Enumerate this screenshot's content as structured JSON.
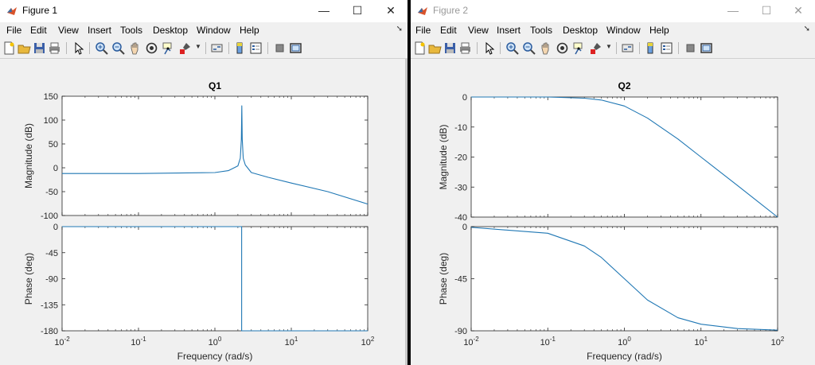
{
  "windows": [
    {
      "title": "Figure 1",
      "controls": {
        "minimize": "—",
        "maximize": "☐",
        "close": "✕"
      },
      "menu": [
        "File",
        "Edit",
        "View",
        "Insert",
        "Tools",
        "Desktop",
        "Window",
        "Help"
      ],
      "toolbar": [
        "new-figure-icon",
        "open-icon",
        "save-icon",
        "print-icon",
        "pointer-icon",
        "zoom-in-icon",
        "zoom-out-icon",
        "pan-icon",
        "rotate-icon",
        "data-cursor-icon",
        "brush-icon",
        "link-icon",
        "colorbar-icon",
        "legend-icon",
        "hide-plot-tools-icon",
        "show-plot-tools-icon"
      ],
      "plot": {
        "title": "Q1",
        "xlabel": "Frequency  (rad/s)",
        "mag_ylabel": "Magnitude (dB)",
        "phase_ylabel": "Phase (deg)",
        "mag_ticks": [
          "150",
          "100",
          "50",
          "0",
          "-50",
          "-100"
        ],
        "phase_ticks": [
          "0",
          "-45",
          "-90",
          "-135",
          "-180"
        ],
        "x_tick_exponents": [
          "-2",
          "-1",
          "0",
          "1",
          "2"
        ]
      }
    },
    {
      "title": "Figure 2",
      "controls": {
        "minimize": "—",
        "maximize": "☐",
        "close": "✕"
      },
      "menu": [
        "File",
        "Edit",
        "View",
        "Insert",
        "Tools",
        "Desktop",
        "Window",
        "Help"
      ],
      "toolbar": [
        "new-figure-icon",
        "open-icon",
        "save-icon",
        "print-icon",
        "pointer-icon",
        "zoom-in-icon",
        "zoom-out-icon",
        "pan-icon",
        "rotate-icon",
        "data-cursor-icon",
        "brush-icon",
        "link-icon",
        "colorbar-icon",
        "legend-icon",
        "hide-plot-tools-icon",
        "show-plot-tools-icon"
      ],
      "plot": {
        "title": "Q2",
        "xlabel": "Frequency  (rad/s)",
        "mag_ylabel": "Magnitude (dB)",
        "phase_ylabel": "Phase (deg)",
        "mag_ticks": [
          "0",
          "-10",
          "-20",
          "-30",
          "-40"
        ],
        "phase_ticks": [
          "0",
          "-45",
          "-90"
        ],
        "x_tick_exponents": [
          "-2",
          "-1",
          "0",
          "1",
          "2"
        ]
      }
    }
  ],
  "chart_data": [
    {
      "type": "line",
      "title": "Q1",
      "xlabel": "Frequency  (rad/s)",
      "xscale": "log",
      "xlim": [
        0.01,
        100
      ],
      "subplots": [
        {
          "ylabel": "Magnitude (dB)",
          "ylim": [
            -100,
            150
          ],
          "x": [
            0.01,
            0.1,
            1,
            1.5,
            2,
            2.15,
            2.22,
            2.25,
            2.28,
            2.35,
            2.5,
            3,
            5,
            10,
            30,
            100
          ],
          "y": [
            -12,
            -12,
            -10,
            -6,
            4,
            20,
            60,
            130,
            60,
            20,
            6,
            -10,
            -20,
            -32,
            -50,
            -76
          ]
        },
        {
          "ylabel": "Phase (deg)",
          "ylim": [
            -180,
            0
          ],
          "x": [
            0.01,
            2.24,
            2.24,
            100
          ],
          "y": [
            0,
            0,
            -180,
            -180
          ]
        }
      ],
      "color": "#1f77b4",
      "grid": false
    },
    {
      "type": "line",
      "title": "Q2",
      "xlabel": "Frequency  (rad/s)",
      "xscale": "log",
      "xlim": [
        0.01,
        100
      ],
      "subplots": [
        {
          "ylabel": "Magnitude (dB)",
          "ylim": [
            -40,
            0
          ],
          "x": [
            0.01,
            0.1,
            0.3,
            0.5,
            1,
            2,
            5,
            10,
            30,
            100
          ],
          "y": [
            0,
            0,
            -0.4,
            -1,
            -3,
            -7,
            -14,
            -20,
            -29.5,
            -40
          ]
        },
        {
          "ylabel": "Phase (deg)",
          "ylim": [
            -90,
            0
          ],
          "x": [
            0.01,
            0.1,
            0.3,
            0.5,
            1,
            2,
            5,
            10,
            30,
            100
          ],
          "y": [
            -0.6,
            -5.7,
            -16.7,
            -26.6,
            -45,
            -63.4,
            -78.7,
            -84.3,
            -88.1,
            -89.4
          ]
        }
      ],
      "color": "#1f77b4",
      "grid": false
    }
  ]
}
